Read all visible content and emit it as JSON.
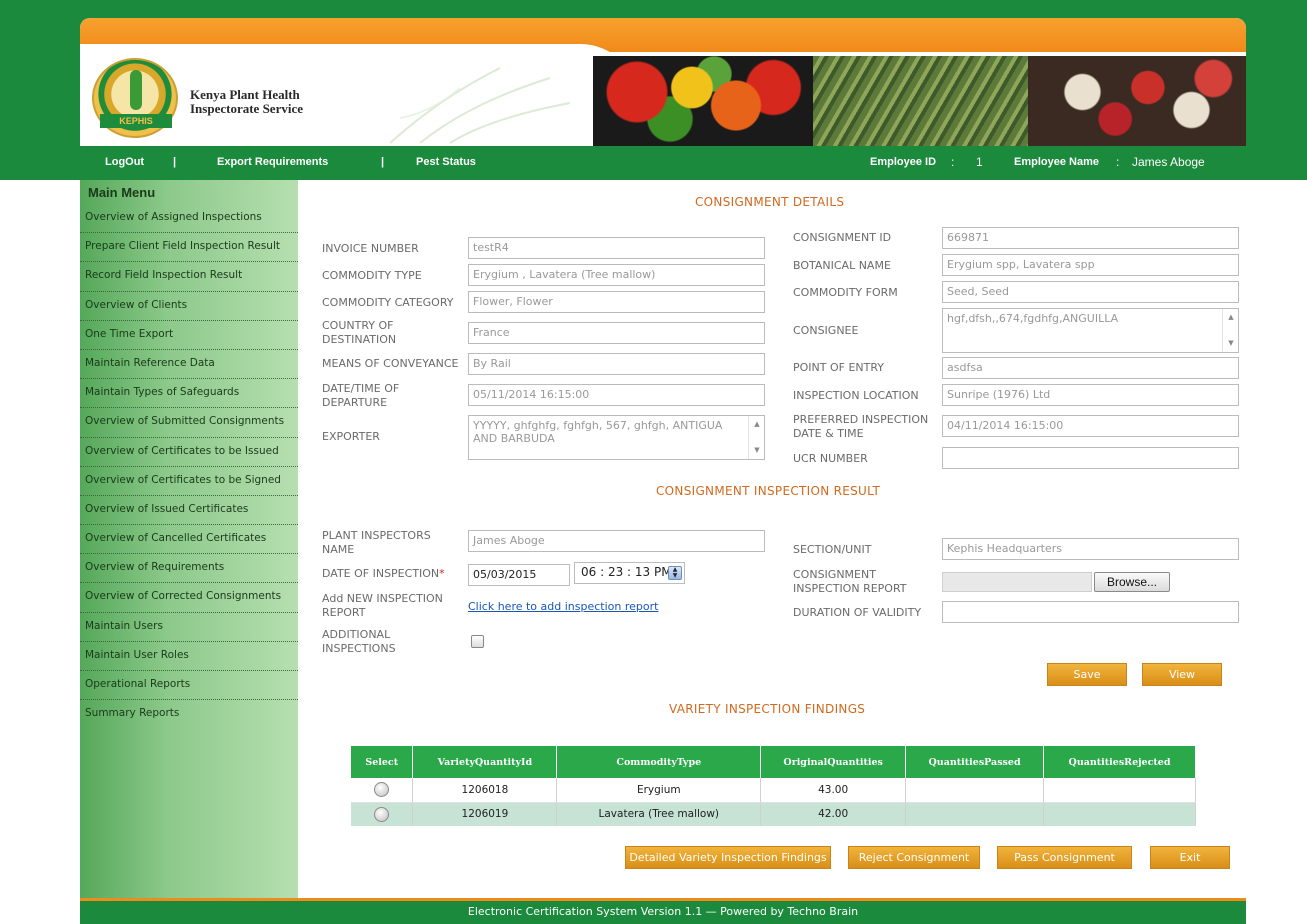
{
  "header": {
    "org_name_line1": "Kenya Plant Health",
    "org_name_line2": "Inspectorate Service",
    "logo_text": "KEPHIS"
  },
  "topnav": {
    "logout": "LogOut",
    "sep1": "|",
    "export_requirements": "Export Requirements",
    "sep2": "|",
    "pest_status": "Pest Status",
    "employee_id_label": "Employee ID",
    "employee_id_colon": ":",
    "employee_id": "1",
    "employee_name_label": "Employee Name",
    "employee_name_colon": ":",
    "employee_name": "James Aboge"
  },
  "sidebar": {
    "title": "Main Menu",
    "items": [
      "Overview of Assigned Inspections",
      "Prepare Client Field Inspection Result",
      "Record Field Inspection Result",
      "Overview of Clients",
      "One Time Export",
      "Maintain Reference Data",
      "Maintain Types of Safeguards",
      "Overview of Submitted Consignments",
      "Overview of Certificates to be Issued",
      "Overview of Certificates to be Signed",
      "Overview of Issued Certificates",
      "Overview of Cancelled Certificates",
      "Overview of Requirements",
      "Overview of Corrected Consignments",
      "Maintain Users",
      "Maintain User Roles",
      "Operational Reports",
      "Summary Reports"
    ]
  },
  "consignment": {
    "title": "CONSIGNMENT DETAILS",
    "invoice_number_label": "INVOICE NUMBER",
    "invoice_number": "testR4",
    "commodity_type_label": "COMMODITY TYPE",
    "commodity_type": "Erygium ,  Lavatera (Tree mallow)",
    "commodity_category_label": "COMMODITY CATEGORY",
    "commodity_category": "Flower, Flower",
    "country_label_1": "COUNTRY OF",
    "country_label_2": "DESTINATION",
    "country": "France",
    "conveyance_label": "MEANS OF CONVEYANCE",
    "conveyance": "By Rail",
    "departure_label_1": "DATE/TIME OF",
    "departure_label_2": "DEPARTURE",
    "departure": "05/11/2014 16:15:00",
    "exporter_label": "EXPORTER",
    "exporter": "YYYYY, ghfghfg, fghfgh, 567, ghfgh, ANTIGUA AND BARBUDA",
    "consignment_id_label": "CONSIGNMENT ID",
    "consignment_id": "669871",
    "botanical_name_label": "BOTANICAL NAME",
    "botanical_name": "Erygium spp, Lavatera spp",
    "commodity_form_label": "COMMODITY FORM",
    "commodity_form": "Seed, Seed",
    "consignee_label": "CONSIGNEE",
    "consignee": "hgf,dfsh,,674,fgdhfg,ANGUILLA",
    "point_of_entry_label": "POINT OF ENTRY",
    "point_of_entry": "asdfsa",
    "inspection_location_label": "INSPECTION LOCATION",
    "inspection_location": "Sunripe (1976) Ltd",
    "preferred_label_1": "PREFERRED INSPECTION",
    "preferred_label_2": "DATE & TIME",
    "preferred": "04/11/2014 16:15:00",
    "ucr_label": "UCR NUMBER",
    "ucr": ""
  },
  "result": {
    "title": "CONSIGNMENT INSPECTION RESULT",
    "inspector_label_1": "PLANT INSPECTORS",
    "inspector_label_2": "NAME",
    "inspector": "James Aboge",
    "date_label": "DATE OF INSPECTION",
    "date_required": "*",
    "date": "05/03/2015",
    "time": "06 : 23 : 13 PM",
    "add_report_label_1": "Add NEW INSPECTION",
    "add_report_label_2": "REPORT",
    "add_report_link": "Click here to add inspection report",
    "additional_label_1": "ADDITIONAL",
    "additional_label_2": "INSPECTIONS",
    "section_label": "SECTION/UNIT",
    "section": "Kephis Headquarters",
    "report_label_1": "CONSIGNMENT",
    "report_label_2": "INSPECTION REPORT",
    "browse": "Browse...",
    "validity_label": "DURATION OF VALIDITY",
    "validity": "",
    "save": "Save",
    "view": "View"
  },
  "findings": {
    "title": "VARIETY INSPECTION FINDINGS",
    "columns": [
      "Select",
      "VarietyQuantityId",
      "CommodityType",
      "OriginalQuantities",
      "QuantitiesPassed",
      "QuantitiesRejected"
    ],
    "rows": [
      {
        "id": "1206018",
        "commodity": "Erygium",
        "original": "43.00",
        "passed": "",
        "rejected": ""
      },
      {
        "id": "1206019",
        "commodity": "Lavatera (Tree mallow)",
        "original": "42.00",
        "passed": "",
        "rejected": ""
      }
    ],
    "btn_detailed": "Detailed Variety Inspection Findings",
    "btn_reject": "Reject Consignment",
    "btn_pass": "Pass Consignment",
    "btn_exit": "Exit"
  },
  "footer": {
    "text": "Electronic Certification System Version 1.1 — Powered by Techno Brain"
  }
}
